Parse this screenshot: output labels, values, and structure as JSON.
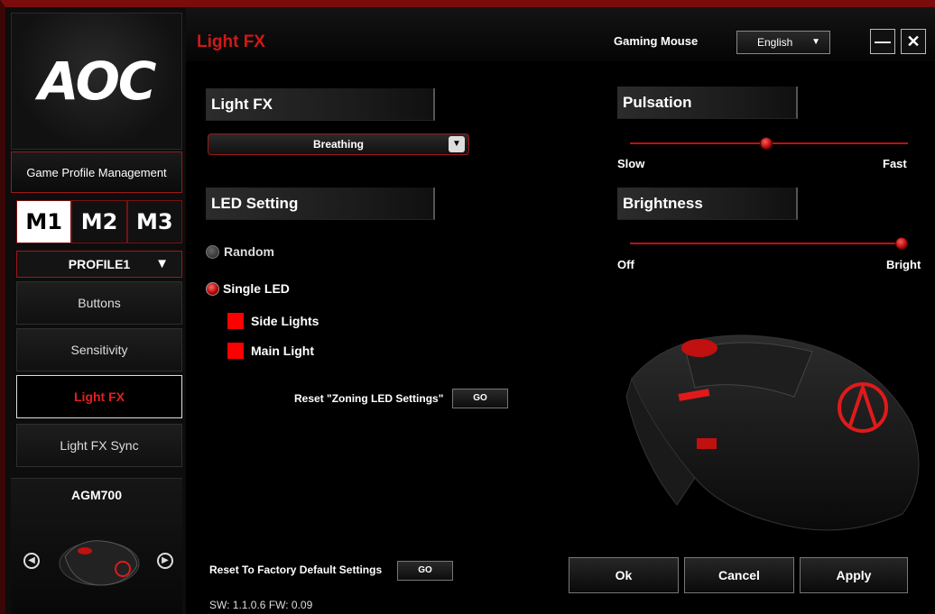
{
  "app": {
    "logo": "AOC"
  },
  "sidebar": {
    "profile_mgmt_label": "Game Profile Management",
    "mode_tabs": [
      "M1",
      "M2",
      "M3"
    ],
    "profile_select": "PROFILE1",
    "nav": [
      "Buttons",
      "Sensitivity",
      "Light FX",
      "Light FX Sync"
    ],
    "device_name": "AGM700"
  },
  "header": {
    "title": "Light FX",
    "device": "Gaming Mouse",
    "language": "English"
  },
  "light_fx": {
    "section_title": "Light FX",
    "effect": "Breathing"
  },
  "led_setting": {
    "section_title": "LED Setting",
    "random_label": "Random",
    "single_label": "Single LED",
    "side_lights_label": "Side Lights",
    "main_light_label": "Main Light",
    "reset_zoning_label": "Reset \"Zoning LED Settings\"",
    "go_label": "GO"
  },
  "pulsation": {
    "section_title": "Pulsation",
    "min_label": "Slow",
    "max_label": "Fast",
    "value_fraction": 0.49
  },
  "brightness": {
    "section_title": "Brightness",
    "min_label": "Off",
    "max_label": "Bright",
    "value_fraction": 1.0
  },
  "footer": {
    "reset_factory_label": "Reset To Factory Default Settings",
    "go_label": "GO",
    "ok_label": "Ok",
    "cancel_label": "Cancel",
    "apply_label": "Apply",
    "version": "SW: 1.1.0.6  FW: 0.09"
  },
  "colors": {
    "accent": "#d01818",
    "led_color": "#ff0000"
  }
}
